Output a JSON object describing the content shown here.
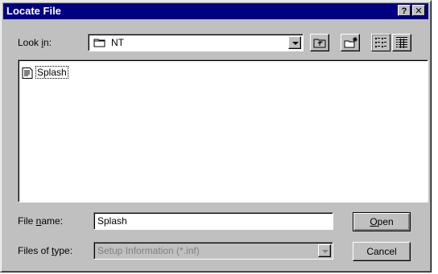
{
  "window": {
    "title": "Locate File",
    "help_label": "?",
    "close_label": "✕"
  },
  "lookin": {
    "label_pre": "Look ",
    "label_key": "i",
    "label_post": "n:",
    "value": "NT",
    "icon": "folder-icon"
  },
  "toolbar": {
    "up_icon": "up-one-level-icon",
    "new_folder_icon": "new-folder-icon",
    "list_icon": "list-view-icon",
    "details_icon": "details-view-icon"
  },
  "files": [
    {
      "name": "Splash",
      "icon": "setup-information-file-icon"
    }
  ],
  "filename": {
    "label_pre": "File ",
    "label_key": "n",
    "label_post": "ame:",
    "value": "Splash"
  },
  "filetype": {
    "label_pre": "Files of ",
    "label_key": "t",
    "label_post": "ype:",
    "value": "Setup Information (*.inf)"
  },
  "buttons": {
    "open_key": "O",
    "open_rest": "pen",
    "cancel": "Cancel"
  },
  "colors": {
    "titlebar": "#000080",
    "face": "#c0c0c0"
  }
}
